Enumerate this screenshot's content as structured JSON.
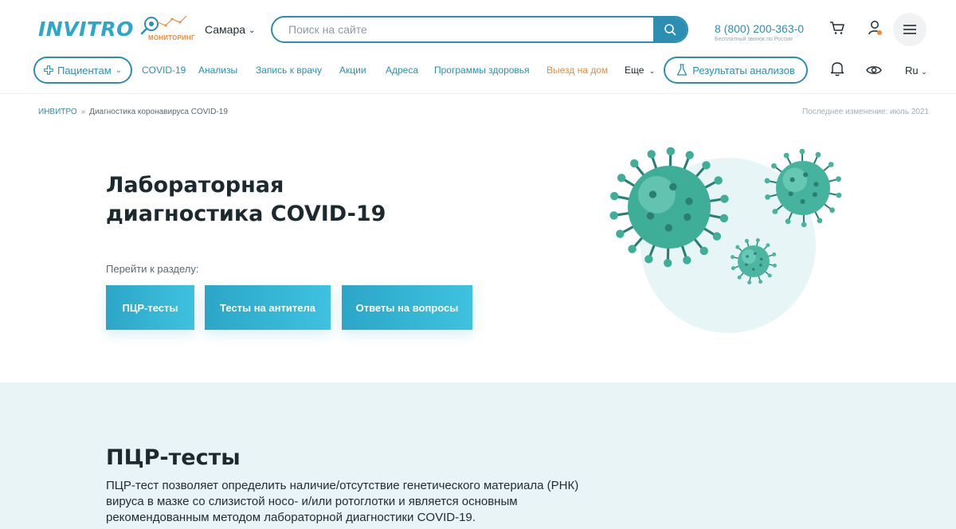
{
  "header": {
    "logo": "INVITRO",
    "badge": "МОНИТОРИНГ",
    "city": "Самара",
    "search_placeholder": "Поиск на сайте",
    "phone": "8 (800) 200-363-0",
    "phone_note": "Бесплатный звонок по России",
    "icons": [
      "search-icon",
      "cart-icon",
      "user-icon",
      "menu-icon"
    ]
  },
  "nav": {
    "patients": "Пациентам",
    "links": [
      "COVID-19",
      "Анализы",
      "Запись к врачу",
      "Акции",
      "Адреса",
      "Программы здоровья",
      "Выезд на дом",
      "Еще"
    ],
    "results": "Результаты анализов",
    "lang": "Ru",
    "icons": [
      "bell-icon",
      "eye-icon",
      "flask-icon"
    ]
  },
  "breadcrumb": {
    "home": "ИНВИТРО",
    "separator": "»",
    "current": "Диагностика коронавируса COVID-19",
    "updated": "Последнее изменение: июль 2021"
  },
  "hero": {
    "title_line1": "Лабораторная",
    "title_line2": "диагностика COVID-19",
    "goto_label": "Перейти к разделу:",
    "buttons": [
      "ПЦР-тесты",
      "Тесты на антитела",
      "Ответы на вопросы"
    ]
  },
  "section": {
    "title": "ПЦР-тесты",
    "text": "ПЦР-тест позволяет определить наличие/отсутствие генетического материала (РНК) вируса в мазке со слизистой носо- и/или ротоглотки и является основным рекомендованным методом лабораторной диагностики COVID-19."
  },
  "colors": {
    "brand": "#2c8fb1",
    "logo": "#2aa7c9",
    "accent_orange": "#f08a3b",
    "button_gradient_start": "#2ca6c8",
    "button_gradient_end": "#3ec2df",
    "section_bg": "#e9f4f6"
  }
}
